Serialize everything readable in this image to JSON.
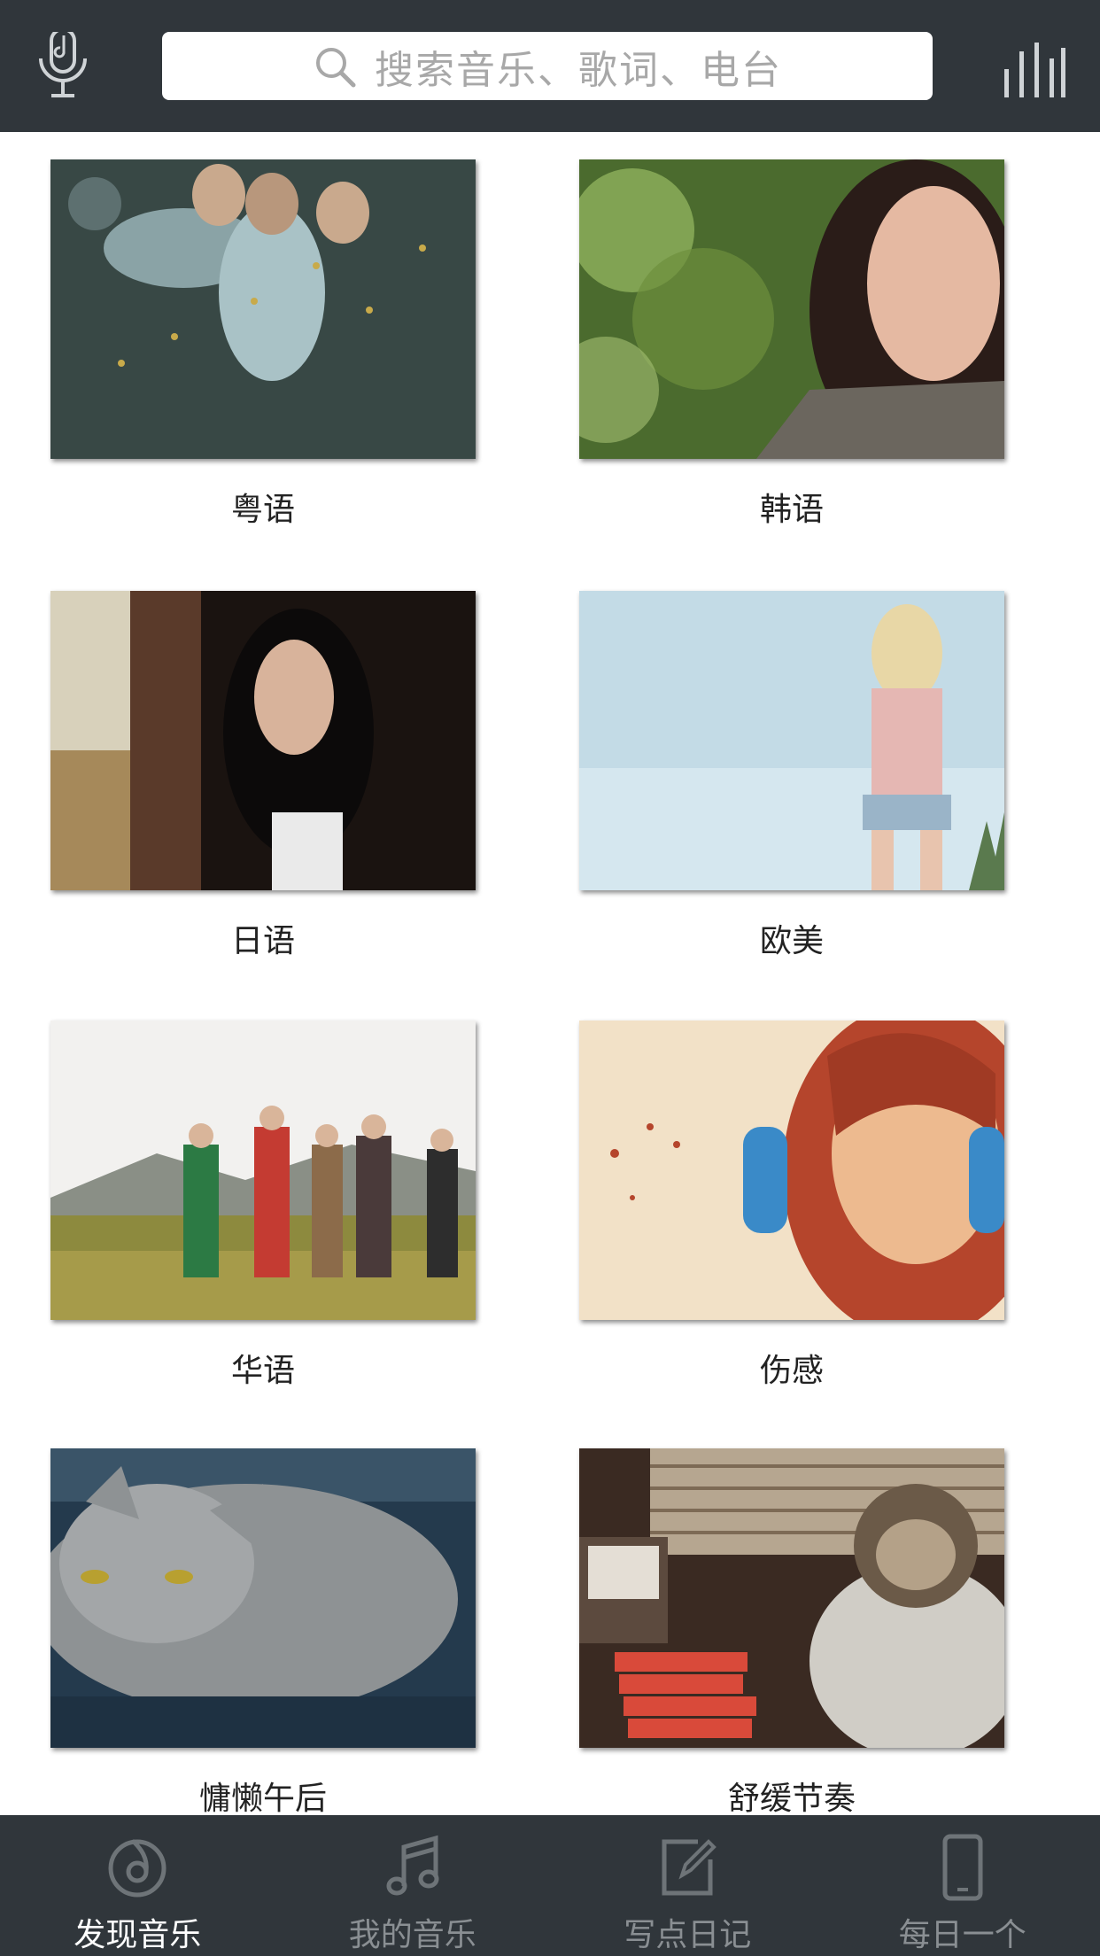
{
  "header": {
    "search_placeholder": "搜索音乐、歌词、电台",
    "left_icon": "microphone-icon",
    "right_icon": "equalizer-icon"
  },
  "categories": [
    {
      "label": "粤语"
    },
    {
      "label": "韩语"
    },
    {
      "label": "日语"
    },
    {
      "label": "欧美"
    },
    {
      "label": "华语"
    },
    {
      "label": "伤感"
    },
    {
      "label": "慵懒午后"
    },
    {
      "label": "舒缓节奏"
    }
  ],
  "bottom_nav": [
    {
      "label": "发现音乐",
      "icon": "discover-music-icon",
      "active": true
    },
    {
      "label": "我的音乐",
      "icon": "music-note-icon",
      "active": false
    },
    {
      "label": "写点日记",
      "icon": "edit-note-icon",
      "active": false
    },
    {
      "label": "每日一个",
      "icon": "phone-icon",
      "active": false
    }
  ],
  "colors": {
    "bar_bg": "#30363b",
    "active_text": "#ffffff",
    "inactive_text": "#8a8f93"
  }
}
